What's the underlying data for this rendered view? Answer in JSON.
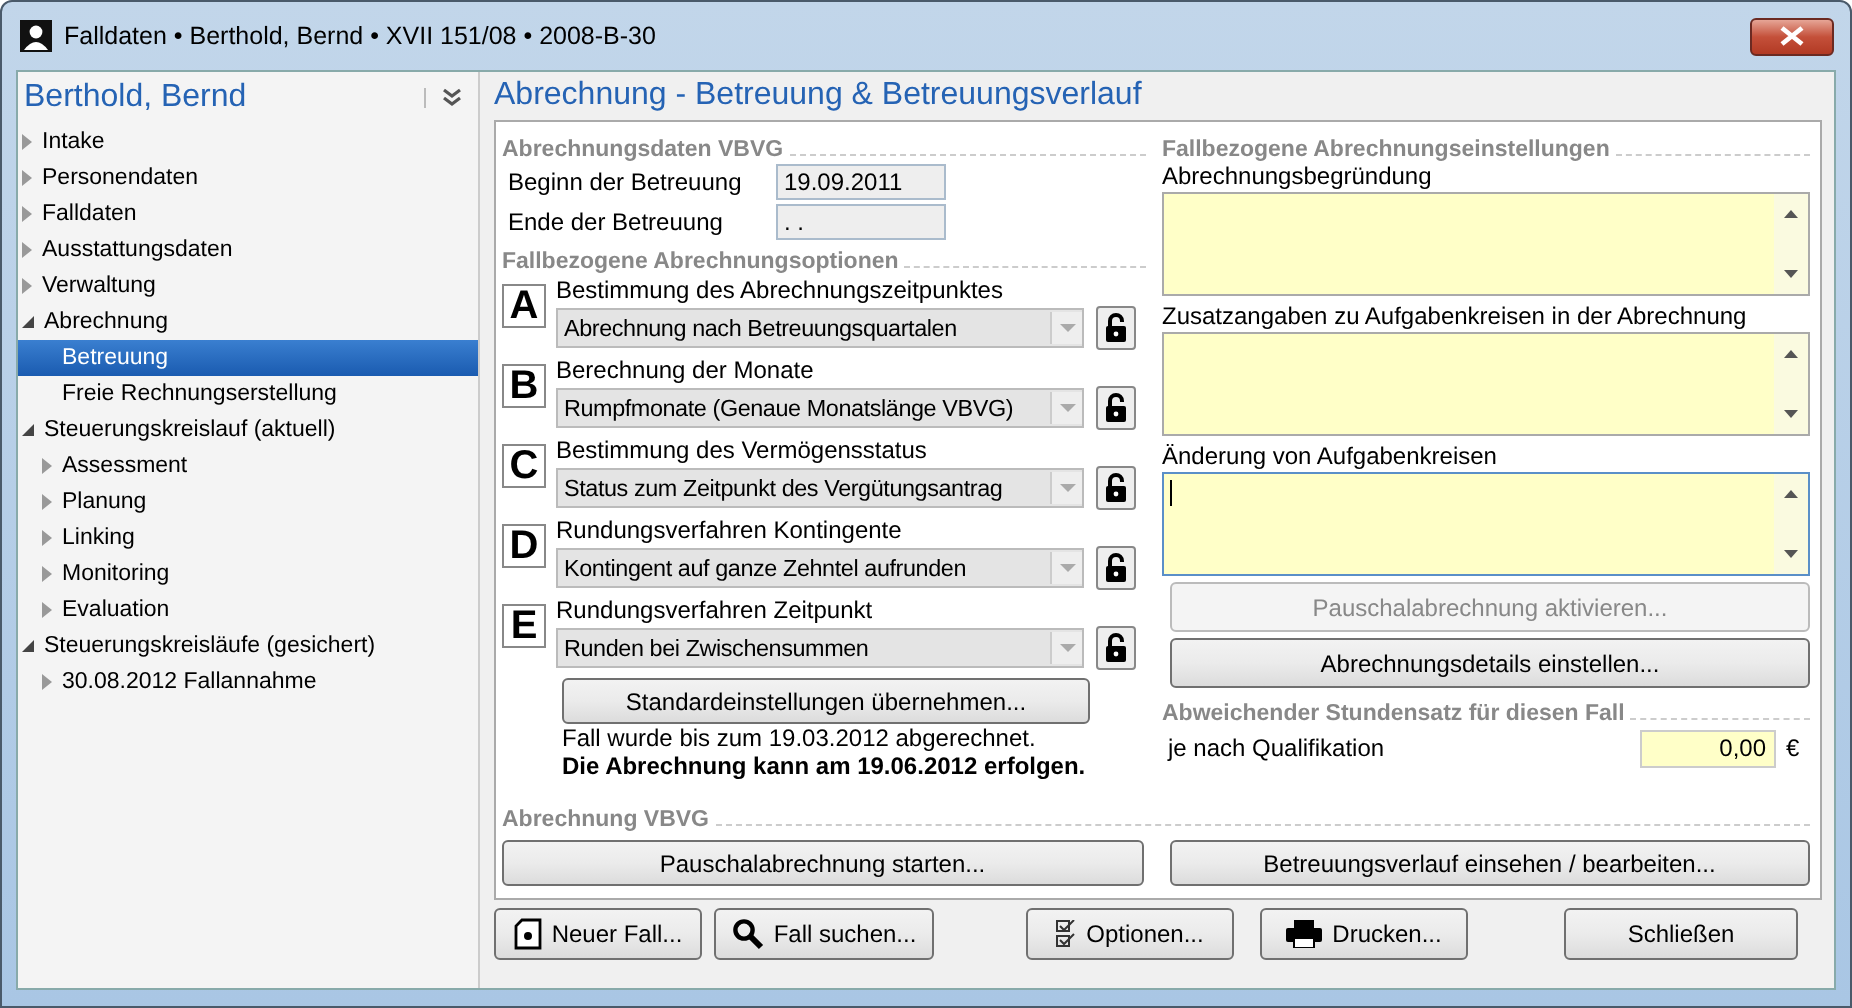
{
  "window": {
    "title": "Falldaten • Berthold, Bernd • XVII 151/08 • 2008-B-30"
  },
  "sidebar": {
    "header": "Berthold, Bernd",
    "items": [
      {
        "label": "Intake",
        "expanded": false,
        "selected": false
      },
      {
        "label": "Personendaten",
        "expanded": false,
        "selected": false
      },
      {
        "label": "Falldaten",
        "expanded": false,
        "selected": false
      },
      {
        "label": "Ausstattungsdaten",
        "expanded": false,
        "selected": false
      },
      {
        "label": "Verwaltung",
        "expanded": false,
        "selected": false
      },
      {
        "label": "Abrechnung",
        "expanded": true,
        "selected": false,
        "children": [
          {
            "label": "Betreuung",
            "selected": true
          },
          {
            "label": "Freie Rechnungserstellung",
            "selected": false
          }
        ]
      },
      {
        "label": "Steuerungskreislauf (aktuell)",
        "expanded": true,
        "selected": false,
        "children": [
          {
            "label": "Assessment",
            "expanded": false,
            "selected": false
          },
          {
            "label": "Planung",
            "expanded": false,
            "selected": false
          },
          {
            "label": "Linking",
            "expanded": false,
            "selected": false
          },
          {
            "label": "Monitoring",
            "expanded": false,
            "selected": false
          },
          {
            "label": "Evaluation",
            "expanded": false,
            "selected": false
          }
        ]
      },
      {
        "label": "Steuerungskreisläufe (gesichert)",
        "expanded": true,
        "selected": false,
        "children": [
          {
            "label": "30.08.2012 Fallannahme",
            "expanded": false,
            "selected": false
          }
        ]
      }
    ]
  },
  "heading": "Abrechnung - Betreuung & Betreuungsverlauf",
  "billing_data": {
    "title": "Abrechnungsdaten VBVG",
    "fields": [
      {
        "label": "Beginn der Betreuung",
        "value": "19.09.2011"
      },
      {
        "label": "Ende der Betreuung",
        "value": ". ."
      }
    ]
  },
  "options": {
    "title": "Fallbezogene Abrechnungsoptionen",
    "items": [
      {
        "letter": "A",
        "label": "Bestimmung des Abrechnungszeitpunktes",
        "value": "Abrechnung nach Betreuungsquartalen"
      },
      {
        "letter": "B",
        "label": "Berechnung der Monate",
        "value": "Rumpfmonate (Genaue Monatslänge VBVG)"
      },
      {
        "letter": "C",
        "label": "Bestimmung des Vermögensstatus",
        "value": "Status zum Zeitpunkt des Vergütungsantrag"
      },
      {
        "letter": "D",
        "label": "Rundungsverfahren Kontingente",
        "value": "Kontingent auf ganze Zehntel aufrunden"
      },
      {
        "letter": "E",
        "label": "Rundungsverfahren Zeitpunkt",
        "value": "Runden bei Zwischensummen"
      }
    ],
    "button": "Standardeinstellungen übernehmen...",
    "notes": [
      {
        "text": "Fall wurde bis zum 19.03.2012 abgerechnet.",
        "bold": false
      },
      {
        "text": "Die Abrechnung kann am 19.06.2012 erfolgen.",
        "bold": true
      }
    ]
  },
  "settings": {
    "title": "Fallbezogene Abrechnungseinstellungen",
    "textareas": [
      {
        "label": "Abrechnungsbegründung",
        "focused": false
      },
      {
        "label": "Zusatzangaben zu Aufgabenkreisen in der Abrechnung",
        "focused": false
      },
      {
        "label": "Änderung von Aufgabenkreisen",
        "focused": true
      }
    ],
    "buttons": [
      {
        "label": "Pauschalabrechnung aktivieren...",
        "disabled": true
      },
      {
        "label": "Abrechnungsdetails einstellen...",
        "disabled": false
      }
    ]
  },
  "rate": {
    "title": "Abweichender Stundensatz für diesen Fall",
    "label": "je nach Qualifikation",
    "value": "0,00",
    "unit": "€"
  },
  "vbvg": {
    "title": "Abrechnung VBVG",
    "buttons": [
      "Pauschalabrechnung starten...",
      "Betreuungsverlauf einsehen / bearbeiten..."
    ]
  },
  "footer": [
    {
      "label": "Neuer Fall...",
      "kind": "new"
    },
    {
      "label": "Fall suchen...",
      "kind": "search"
    },
    {
      "label": "Optionen...",
      "kind": "options"
    },
    {
      "label": "Drucken...",
      "kind": "print"
    },
    {
      "label": "Schließen",
      "kind": "plain"
    }
  ]
}
